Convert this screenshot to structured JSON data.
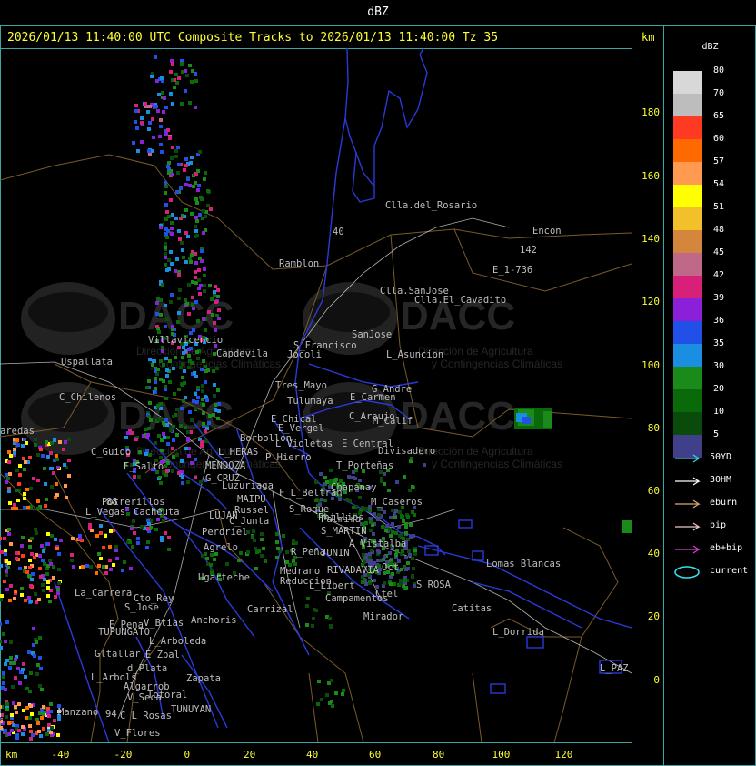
{
  "window": {
    "title": "dBZ"
  },
  "header": {
    "title": "2026/01/13 11:40:00 UTC Composite Tracks to 2026/01/13 11:40:00 Tz 35",
    "km_label": "km"
  },
  "axes": {
    "y_unit": "km",
    "x_unit": "km",
    "y_ticks": [
      "180",
      "160",
      "140",
      "120",
      "100",
      "80",
      "60",
      "40",
      "20",
      "0"
    ],
    "x_ticks": [
      "-40",
      "-20",
      "0",
      "20",
      "40",
      "60",
      "80",
      "100",
      "120"
    ]
  },
  "legend": {
    "title": "dBZ",
    "scale": [
      {
        "label": "80",
        "color": "#d8d8d8"
      },
      {
        "label": "70",
        "color": "#bdbdbd"
      },
      {
        "label": "65",
        "color": "#ff3a22"
      },
      {
        "label": "60",
        "color": "#ff6a00"
      },
      {
        "label": "57",
        "color": "#ff9a50"
      },
      {
        "label": "54",
        "color": "#ffff00"
      },
      {
        "label": "51",
        "color": "#f2c02a"
      },
      {
        "label": "48",
        "color": "#d4863c"
      },
      {
        "label": "45",
        "color": "#c06888"
      },
      {
        "label": "42",
        "color": "#d8207a"
      },
      {
        "label": "39",
        "color": "#8a20d8"
      },
      {
        "label": "36",
        "color": "#2050e8"
      },
      {
        "label": "35",
        "color": "#1a8ee0"
      },
      {
        "label": "30",
        "color": "#1a8a1a"
      },
      {
        "label": "20",
        "color": "#0a6a0a"
      },
      {
        "label": "10",
        "color": "#0a4a0a"
      },
      {
        "label": "5",
        "color": "#40408a"
      }
    ],
    "tracks": [
      {
        "label": "50YD",
        "color": "#40d0e0"
      },
      {
        "label": "30HM",
        "color": "#ffffff"
      },
      {
        "label": "eburn",
        "color": "#d8a878"
      },
      {
        "label": "bip",
        "color": "#f0c8c8"
      },
      {
        "label": "eb+bip",
        "color": "#d040d0"
      },
      {
        "label": "current",
        "color": "#30e0f0"
      }
    ]
  },
  "watermark": {
    "logo_text": "DACC",
    "subtitle_1": "Dirección de Agricultura",
    "subtitle_2": "y Contingencias Climáticas"
  },
  "map": {
    "places": [
      {
        "name": "Clla.del_Rosario"
      },
      {
        "name": "Ramblon"
      },
      {
        "name": "Encon"
      },
      {
        "name": "142"
      },
      {
        "name": "E_1-736"
      },
      {
        "name": "Clla.SanJose"
      },
      {
        "name": "Clla.El_Cavadito"
      },
      {
        "name": "S_Francisco"
      },
      {
        "name": "SanJose"
      },
      {
        "name": "L_Asuncion"
      },
      {
        "name": "Villavicencio"
      },
      {
        "name": "Uspallata"
      },
      {
        "name": "Capdevila"
      },
      {
        "name": "Jocoli"
      },
      {
        "name": "Tres_Mayo"
      },
      {
        "name": "G_Andre"
      },
      {
        "name": "C_Chilenos"
      },
      {
        "name": "Tulumaya"
      },
      {
        "name": "E_Carmen"
      },
      {
        "name": "E_Chical"
      },
      {
        "name": "C_Araujo"
      },
      {
        "name": "M_Calif"
      },
      {
        "name": "E_Vergel"
      },
      {
        "name": "aredas"
      },
      {
        "name": "Borbollon"
      },
      {
        "name": "L_Violetas"
      },
      {
        "name": "E_Central"
      },
      {
        "name": "Divisadero"
      },
      {
        "name": "C_Guido"
      },
      {
        "name": "L_HERAS"
      },
      {
        "name": "P_Hierro"
      },
      {
        "name": "E_Salto"
      },
      {
        "name": "MENDOZA"
      },
      {
        "name": "T_Porteñas"
      },
      {
        "name": "G_CRUZ"
      },
      {
        "name": "Luzuriaga"
      },
      {
        "name": "F_L_Beltran"
      },
      {
        "name": "Chapanay"
      },
      {
        "name": "Potrerillos"
      },
      {
        "name": "MAIPU"
      },
      {
        "name": "Russel"
      },
      {
        "name": "Phillips"
      },
      {
        "name": "M_Caseros"
      },
      {
        "name": "L_Vegas"
      },
      {
        "name": "Cacheuta"
      },
      {
        "name": "LUJAN"
      },
      {
        "name": "C_Junta"
      },
      {
        "name": "S_Roque"
      },
      {
        "name": "Palmira"
      },
      {
        "name": "Perdriel"
      },
      {
        "name": "S_MARTIN"
      },
      {
        "name": "A_Vistalba"
      },
      {
        "name": "Agrelo"
      },
      {
        "name": "R_Peña"
      },
      {
        "name": "JUNIN"
      },
      {
        "name": "Lomas_Blancas"
      },
      {
        "name": "Ugarteche"
      },
      {
        "name": "Medrano"
      },
      {
        "name": "RIVADAVIA"
      },
      {
        "name": "Oct"
      },
      {
        "name": "Reduccion"
      },
      {
        "name": "L_Libert"
      },
      {
        "name": "S_ROSA"
      },
      {
        "name": "La_Carrera"
      },
      {
        "name": "Campamentos"
      },
      {
        "name": "Ctel"
      },
      {
        "name": "Cto_Rey"
      },
      {
        "name": "Catitas"
      },
      {
        "name": "S_Jose"
      },
      {
        "name": "Carrizal"
      },
      {
        "name": "E_Pena"
      },
      {
        "name": "V_Btias"
      },
      {
        "name": "Anchoris"
      },
      {
        "name": "Mirador"
      },
      {
        "name": "TUPUNGATO"
      },
      {
        "name": "L_Dorrida"
      },
      {
        "name": "L_Arboleda"
      },
      {
        "name": "Gltallar"
      },
      {
        "name": "E_Zpal"
      },
      {
        "name": "L_Arbols"
      },
      {
        "name": "d_Plata"
      },
      {
        "name": "Zapata"
      },
      {
        "name": "L_PAZ"
      },
      {
        "name": "V_Seca"
      },
      {
        "name": "Algarrob"
      },
      {
        "name": "Totoral"
      },
      {
        "name": "TUNUYAN"
      },
      {
        "name": "Manzano"
      },
      {
        "name": "C_L_Rosas"
      },
      {
        "name": "V_Flores"
      },
      {
        "name": "88"
      },
      {
        "name": "94"
      },
      {
        "name": "40"
      }
    ]
  }
}
